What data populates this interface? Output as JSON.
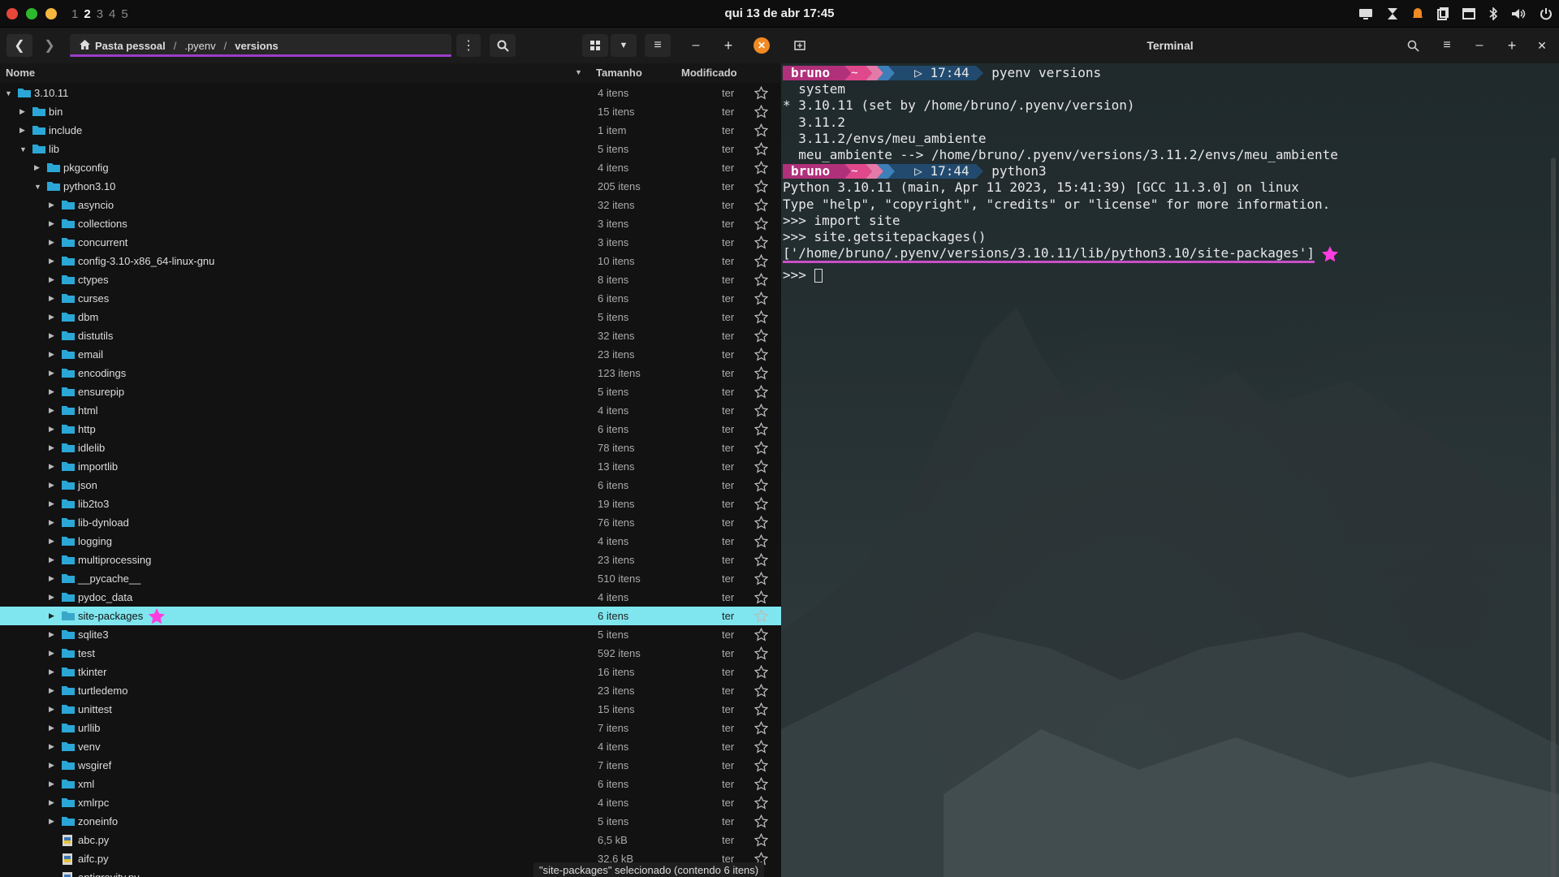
{
  "topbar": {
    "workspaces": [
      "1",
      "2",
      "3",
      "4",
      "5"
    ],
    "active_workspace": "2",
    "clock": "qui 13 de abr  17:45",
    "colors": {
      "close": "#e8463b",
      "min": "#2eb82e",
      "max": "#f4b73f"
    }
  },
  "fm": {
    "breadcrumb": [
      "Pasta pessoal",
      ".pyenv",
      "versions"
    ],
    "columns": {
      "name": "Nome",
      "size": "Tamanho",
      "modified": "Modificado"
    },
    "rows": [
      {
        "name": "3.10.11",
        "size": "4 itens",
        "mod": "ter",
        "depth": 0,
        "expanded": true,
        "type": "folder"
      },
      {
        "name": "bin",
        "size": "15 itens",
        "mod": "ter",
        "depth": 1,
        "expanded": false,
        "type": "folder"
      },
      {
        "name": "include",
        "size": "1 item",
        "mod": "ter",
        "depth": 1,
        "expanded": false,
        "type": "folder"
      },
      {
        "name": "lib",
        "size": "5 itens",
        "mod": "ter",
        "depth": 1,
        "expanded": true,
        "type": "folder"
      },
      {
        "name": "pkgconfig",
        "size": "4 itens",
        "mod": "ter",
        "depth": 2,
        "expanded": false,
        "type": "folder"
      },
      {
        "name": "python3.10",
        "size": "205 itens",
        "mod": "ter",
        "depth": 2,
        "expanded": true,
        "type": "folder"
      },
      {
        "name": "asyncio",
        "size": "32 itens",
        "mod": "ter",
        "depth": 3,
        "expanded": false,
        "type": "folder"
      },
      {
        "name": "collections",
        "size": "3 itens",
        "mod": "ter",
        "depth": 3,
        "expanded": false,
        "type": "folder"
      },
      {
        "name": "concurrent",
        "size": "3 itens",
        "mod": "ter",
        "depth": 3,
        "expanded": false,
        "type": "folder"
      },
      {
        "name": "config-3.10-x86_64-linux-gnu",
        "size": "10 itens",
        "mod": "ter",
        "depth": 3,
        "expanded": false,
        "type": "folder"
      },
      {
        "name": "ctypes",
        "size": "8 itens",
        "mod": "ter",
        "depth": 3,
        "expanded": false,
        "type": "folder"
      },
      {
        "name": "curses",
        "size": "6 itens",
        "mod": "ter",
        "depth": 3,
        "expanded": false,
        "type": "folder"
      },
      {
        "name": "dbm",
        "size": "5 itens",
        "mod": "ter",
        "depth": 3,
        "expanded": false,
        "type": "folder"
      },
      {
        "name": "distutils",
        "size": "32 itens",
        "mod": "ter",
        "depth": 3,
        "expanded": false,
        "type": "folder"
      },
      {
        "name": "email",
        "size": "23 itens",
        "mod": "ter",
        "depth": 3,
        "expanded": false,
        "type": "folder"
      },
      {
        "name": "encodings",
        "size": "123 itens",
        "mod": "ter",
        "depth": 3,
        "expanded": false,
        "type": "folder"
      },
      {
        "name": "ensurepip",
        "size": "5 itens",
        "mod": "ter",
        "depth": 3,
        "expanded": false,
        "type": "folder"
      },
      {
        "name": "html",
        "size": "4 itens",
        "mod": "ter",
        "depth": 3,
        "expanded": false,
        "type": "folder"
      },
      {
        "name": "http",
        "size": "6 itens",
        "mod": "ter",
        "depth": 3,
        "expanded": false,
        "type": "folder"
      },
      {
        "name": "idlelib",
        "size": "78 itens",
        "mod": "ter",
        "depth": 3,
        "expanded": false,
        "type": "folder"
      },
      {
        "name": "importlib",
        "size": "13 itens",
        "mod": "ter",
        "depth": 3,
        "expanded": false,
        "type": "folder"
      },
      {
        "name": "json",
        "size": "6 itens",
        "mod": "ter",
        "depth": 3,
        "expanded": false,
        "type": "folder"
      },
      {
        "name": "lib2to3",
        "size": "19 itens",
        "mod": "ter",
        "depth": 3,
        "expanded": false,
        "type": "folder"
      },
      {
        "name": "lib-dynload",
        "size": "76 itens",
        "mod": "ter",
        "depth": 3,
        "expanded": false,
        "type": "folder"
      },
      {
        "name": "logging",
        "size": "4 itens",
        "mod": "ter",
        "depth": 3,
        "expanded": false,
        "type": "folder"
      },
      {
        "name": "multiprocessing",
        "size": "23 itens",
        "mod": "ter",
        "depth": 3,
        "expanded": false,
        "type": "folder"
      },
      {
        "name": "__pycache__",
        "size": "510 itens",
        "mod": "ter",
        "depth": 3,
        "expanded": false,
        "type": "folder"
      },
      {
        "name": "pydoc_data",
        "size": "4 itens",
        "mod": "ter",
        "depth": 3,
        "expanded": false,
        "type": "folder"
      },
      {
        "name": "site-packages",
        "size": "6 itens",
        "mod": "ter",
        "depth": 3,
        "expanded": false,
        "type": "folder",
        "selected": true
      },
      {
        "name": "sqlite3",
        "size": "5 itens",
        "mod": "ter",
        "depth": 3,
        "expanded": false,
        "type": "folder"
      },
      {
        "name": "test",
        "size": "592 itens",
        "mod": "ter",
        "depth": 3,
        "expanded": false,
        "type": "folder"
      },
      {
        "name": "tkinter",
        "size": "16 itens",
        "mod": "ter",
        "depth": 3,
        "expanded": false,
        "type": "folder"
      },
      {
        "name": "turtledemo",
        "size": "23 itens",
        "mod": "ter",
        "depth": 3,
        "expanded": false,
        "type": "folder"
      },
      {
        "name": "unittest",
        "size": "15 itens",
        "mod": "ter",
        "depth": 3,
        "expanded": false,
        "type": "folder"
      },
      {
        "name": "urllib",
        "size": "7 itens",
        "mod": "ter",
        "depth": 3,
        "expanded": false,
        "type": "folder"
      },
      {
        "name": "venv",
        "size": "4 itens",
        "mod": "ter",
        "depth": 3,
        "expanded": false,
        "type": "folder"
      },
      {
        "name": "wsgiref",
        "size": "7 itens",
        "mod": "ter",
        "depth": 3,
        "expanded": false,
        "type": "folder"
      },
      {
        "name": "xml",
        "size": "6 itens",
        "mod": "ter",
        "depth": 3,
        "expanded": false,
        "type": "folder"
      },
      {
        "name": "xmlrpc",
        "size": "4 itens",
        "mod": "ter",
        "depth": 3,
        "expanded": false,
        "type": "folder"
      },
      {
        "name": "zoneinfo",
        "size": "5 itens",
        "mod": "ter",
        "depth": 3,
        "expanded": false,
        "type": "folder"
      },
      {
        "name": "abc.py",
        "size": "6,5 kB",
        "mod": "ter",
        "depth": 3,
        "type": "file"
      },
      {
        "name": "aifc.py",
        "size": "32,6 kB",
        "mod": "ter",
        "depth": 3,
        "type": "file"
      },
      {
        "name": "antigravity.py",
        "size": "",
        "mod": "",
        "depth": 3,
        "type": "file"
      }
    ],
    "status": "\"site-packages\" selecionado (contendo 6 itens)",
    "colors": {
      "folder": "#2aa7d6",
      "selection": "#7fe6ef",
      "path_underline": "#9b3ec8",
      "highlight_star": "#ff3de0"
    }
  },
  "terminal": {
    "title": "Terminal",
    "prompt_user": "bruno",
    "prompt_dir": "~",
    "lines": [
      {
        "kind": "prompt",
        "time": "17:44",
        "cmd": "pyenv versions"
      },
      {
        "kind": "out",
        "text": "  system"
      },
      {
        "kind": "out",
        "text": "* 3.10.11 (set by /home/bruno/.pyenv/version)"
      },
      {
        "kind": "out",
        "text": "  3.11.2"
      },
      {
        "kind": "out",
        "text": "  3.11.2/envs/meu_ambiente"
      },
      {
        "kind": "out",
        "text": "  meu_ambiente --> /home/bruno/.pyenv/versions/3.11.2/envs/meu_ambiente"
      },
      {
        "kind": "prompt",
        "time": "17:44",
        "cmd": "python3"
      },
      {
        "kind": "out",
        "text": "Python 3.10.11 (main, Apr 11 2023, 15:41:39) [GCC 11.3.0] on linux"
      },
      {
        "kind": "out",
        "text": "Type \"help\", \"copyright\", \"credits\" or \"license\" for more information."
      },
      {
        "kind": "out",
        "text": ">>> import site"
      },
      {
        "kind": "out",
        "text": ">>> site.getsitepackages()"
      },
      {
        "kind": "hl",
        "text": "['/home/bruno/.pyenv/versions/3.10.11/lib/python3.10/site-packages']"
      },
      {
        "kind": "cursor",
        "text": ">>> "
      }
    ],
    "colors": {
      "user_bg": "#b0307a",
      "time_bg": "#214a6e",
      "arrow1": "#e0488c",
      "arrow2": "#3d7fb8",
      "arrow3": "#2b5f8f",
      "highlight": "#c94fc9"
    }
  }
}
